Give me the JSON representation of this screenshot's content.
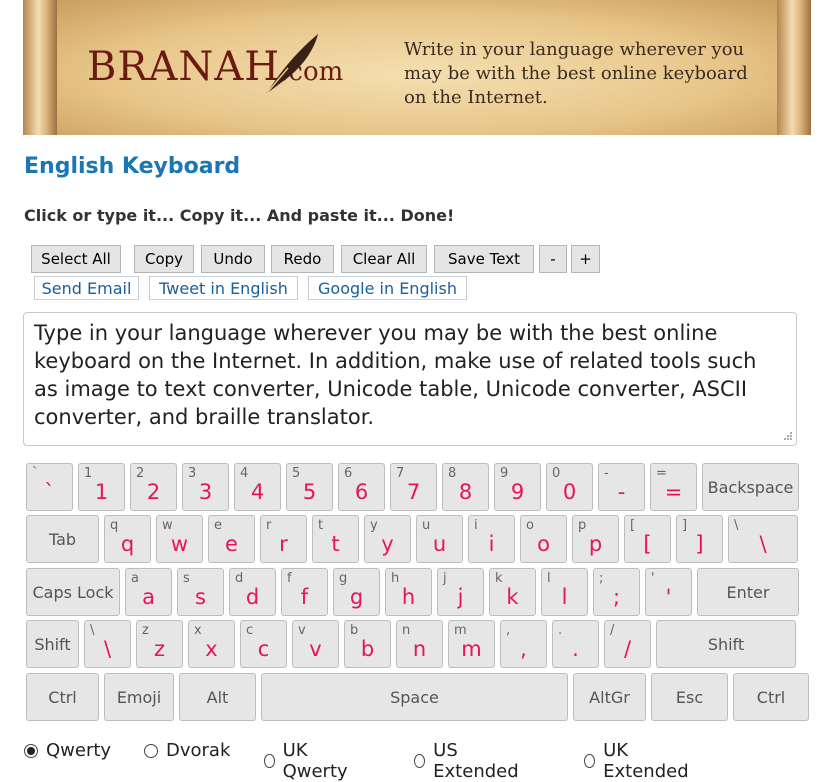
{
  "banner": {
    "logo_main": "BRANAH",
    "logo_suffix": ".com",
    "tagline": "Write in your language wherever you may be with the best online keyboard on the Internet."
  },
  "page_title": "English Keyboard",
  "subtitle": "Click or type it... Copy it... And paste it... Done!",
  "toolbar": {
    "select_all": "Select All",
    "copy": "Copy",
    "undo": "Undo",
    "redo": "Redo",
    "clear_all": "Clear All",
    "save_text": "Save Text",
    "font_smaller": "-",
    "font_larger": "+"
  },
  "share": {
    "send_email": "Send Email",
    "tweet": "Tweet in English",
    "google": "Google in English"
  },
  "editor": {
    "text": "Type in your language wherever you may be with the best online keyboard on the Internet. In addition, make use of related tools such as image to text converter, Unicode table, Unicode converter, ASCII converter, and braille translator."
  },
  "keyboard": {
    "rows": [
      [
        {
          "sub": "`",
          "main": "`"
        },
        {
          "sub": "1",
          "main": "1"
        },
        {
          "sub": "2",
          "main": "2"
        },
        {
          "sub": "3",
          "main": "3"
        },
        {
          "sub": "4",
          "main": "4"
        },
        {
          "sub": "5",
          "main": "5"
        },
        {
          "sub": "6",
          "main": "6"
        },
        {
          "sub": "7",
          "main": "7"
        },
        {
          "sub": "8",
          "main": "8"
        },
        {
          "sub": "9",
          "main": "9"
        },
        {
          "sub": "0",
          "main": "0"
        },
        {
          "sub": "-",
          "main": "-"
        },
        {
          "sub": "=",
          "main": "="
        },
        {
          "label": "Backspace"
        }
      ],
      [
        {
          "label": "Tab"
        },
        {
          "sub": "q",
          "main": "q"
        },
        {
          "sub": "w",
          "main": "w"
        },
        {
          "sub": "e",
          "main": "e"
        },
        {
          "sub": "r",
          "main": "r"
        },
        {
          "sub": "t",
          "main": "t"
        },
        {
          "sub": "y",
          "main": "y"
        },
        {
          "sub": "u",
          "main": "u"
        },
        {
          "sub": "i",
          "main": "i"
        },
        {
          "sub": "o",
          "main": "o"
        },
        {
          "sub": "p",
          "main": "p"
        },
        {
          "sub": "[",
          "main": "["
        },
        {
          "sub": "]",
          "main": "]"
        },
        {
          "sub": "\\",
          "main": "\\"
        }
      ],
      [
        {
          "label": "Caps Lock"
        },
        {
          "sub": "a",
          "main": "a"
        },
        {
          "sub": "s",
          "main": "s"
        },
        {
          "sub": "d",
          "main": "d"
        },
        {
          "sub": "f",
          "main": "f"
        },
        {
          "sub": "g",
          "main": "g"
        },
        {
          "sub": "h",
          "main": "h"
        },
        {
          "sub": "j",
          "main": "j"
        },
        {
          "sub": "k",
          "main": "k"
        },
        {
          "sub": "l",
          "main": "l"
        },
        {
          "sub": ";",
          "main": ";"
        },
        {
          "sub": "'",
          "main": "'"
        },
        {
          "label": "Enter"
        }
      ],
      [
        {
          "label": "Shift"
        },
        {
          "sub": "\\",
          "main": "\\"
        },
        {
          "sub": "z",
          "main": "z"
        },
        {
          "sub": "x",
          "main": "x"
        },
        {
          "sub": "c",
          "main": "c"
        },
        {
          "sub": "v",
          "main": "v"
        },
        {
          "sub": "b",
          "main": "b"
        },
        {
          "sub": "n",
          "main": "n"
        },
        {
          "sub": "m",
          "main": "m"
        },
        {
          "sub": ",",
          "main": ","
        },
        {
          "sub": ".",
          "main": "."
        },
        {
          "sub": "/",
          "main": "/"
        },
        {
          "label": "Shift"
        }
      ],
      [
        {
          "label": "Ctrl"
        },
        {
          "label": "Emoji"
        },
        {
          "label": "Alt"
        },
        {
          "label": "Space"
        },
        {
          "label": "AltGr"
        },
        {
          "label": "Esc"
        },
        {
          "label": "Ctrl"
        }
      ]
    ]
  },
  "layouts": [
    {
      "label": "Qwerty",
      "checked": true
    },
    {
      "label": "Dvorak",
      "checked": false
    },
    {
      "label": "UK Qwerty",
      "checked": false
    },
    {
      "label": "US Extended",
      "checked": false
    },
    {
      "label": "UK Extended",
      "checked": false
    }
  ]
}
